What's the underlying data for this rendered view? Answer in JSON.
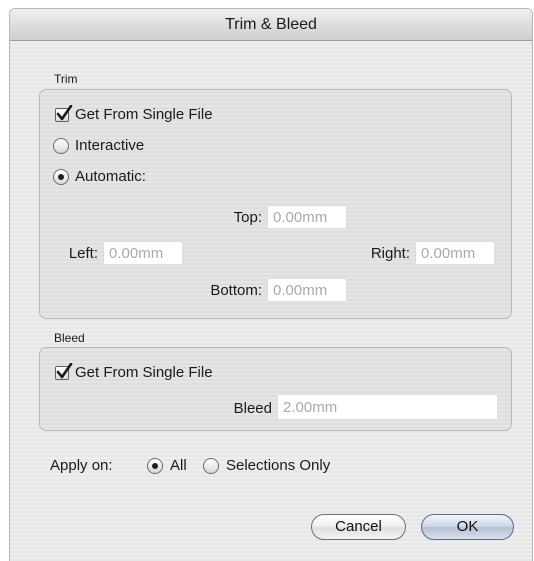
{
  "window": {
    "title": "Trim & Bleed"
  },
  "trim": {
    "section_label": "Trim",
    "get_from_single_file": {
      "label": "Get From Single File",
      "checked": true
    },
    "mode_options": [
      {
        "label": "Interactive",
        "selected": false
      },
      {
        "label": "Automatic:",
        "selected": true
      }
    ],
    "fields": {
      "top": {
        "label": "Top:",
        "value": "0.00mm"
      },
      "left": {
        "label": "Left:",
        "value": "0.00mm"
      },
      "right": {
        "label": "Right:",
        "value": "0.00mm"
      },
      "bottom": {
        "label": "Bottom:",
        "value": "0.00mm"
      }
    }
  },
  "bleed": {
    "section_label": "Bleed",
    "get_from_single_file": {
      "label": "Get From Single File",
      "checked": true
    },
    "field": {
      "label": "Bleed",
      "value": "2.00mm"
    }
  },
  "apply_on": {
    "label": "Apply on:",
    "options": [
      {
        "label": "All",
        "selected": true
      },
      {
        "label": "Selections Only",
        "selected": false
      }
    ]
  },
  "buttons": {
    "cancel": "Cancel",
    "ok": "OK"
  },
  "icons": {
    "checkmark": "checkmark-icon",
    "radio_dot": "radio-dot-icon"
  }
}
